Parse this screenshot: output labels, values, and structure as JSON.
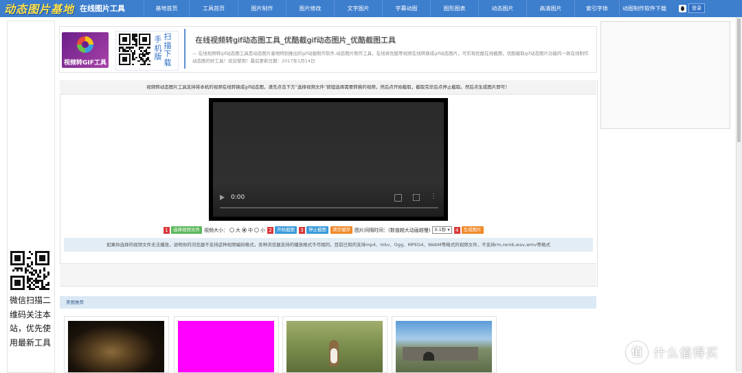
{
  "nav": {
    "logo_main": "动态图片基地",
    "logo_sub": "在线图片工具",
    "items": [
      {
        "label": "基地首页"
      },
      {
        "label": "工具首页"
      },
      {
        "label": "图片制作"
      },
      {
        "label": "图片修改"
      },
      {
        "label": "文字图片"
      },
      {
        "label": "字幕动图"
      },
      {
        "label": "图形图表"
      },
      {
        "label": "动态图片"
      },
      {
        "label": "高清图片"
      },
      {
        "label": "索引字体"
      },
      {
        "label": "动图制作软件下载"
      }
    ],
    "login_label": "登录"
  },
  "left": {
    "scan_text": "微信扫描二维码关注本站，优先使用最新工具"
  },
  "header": {
    "logo_caption": "视频转GIF工具",
    "mobile_text": "手机版扫描下载",
    "mobile_col1": "手机版",
    "mobile_col2": "扫描下载",
    "title": "在线视频转gif动态图工具_优酷截gif动态图片_优酷截图工具",
    "description": "— 在线视频转gif动态图工具是动态图片基地特别推出的gif动画制作软件,动态图片制作工具，在线将优酷等视频在线转换成gif动态图片，可实现优酷在线截图，优酷截取gif动态图片功能的一款在线制作动态图的好工具！欢迎使用！最后更新日期：2017年1月14日"
  },
  "tool": {
    "instructions": "视频转动态图片工具支持将本机的视频在线转换成gif动态图，请先点击下方“选择视频文件”按钮选择需要转换的视频，然后点开始截取，截取完毕后点停止截取。然后点生成图片即可！",
    "video_time": "0:00",
    "steps": [
      "1",
      "2",
      "3",
      "4"
    ],
    "btn_select": "选择视频文件",
    "size_label": "视频大小：",
    "size_options": [
      "大",
      "中",
      "小"
    ],
    "size_selected": "中",
    "btn_start": "开始截图",
    "btn_stop": "停止截图",
    "btn_clear": "清空缓存",
    "interval_label": "图片间隔时间：(数值越大动画越慢)",
    "interval_value": "0.1秒",
    "btn_generate": "生成图片",
    "info": "如果你选择的视频文件无法播放，说明你的浏览器不支持这种视频编码格式，各种浏览器支持的播放格式不尽相同，目前已知的支持mp4、mkv、Ogg、MPEG4、WebM等格式的视频文件，不支持rm,remb,wav,wmv等格式"
  },
  "gallery": {
    "heading": "美图推荐"
  },
  "watermark": {
    "text": "什么值得买",
    "icon_char": "值"
  },
  "colors": {
    "nav_bg": "#3d7ecd",
    "btn_green": "#5cb85c",
    "btn_blue": "#3a9ad9",
    "btn_orange": "#ef8a2b",
    "step_red": "#d9383a",
    "info_bg": "#e2edf6"
  }
}
